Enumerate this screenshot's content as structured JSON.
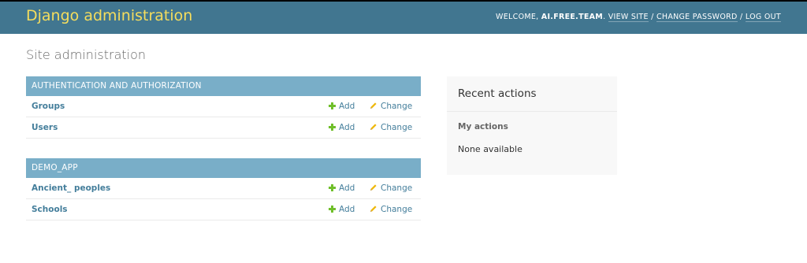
{
  "header": {
    "site_name": "Django administration",
    "welcome": "WELCOME,",
    "username": "AI.FREE.TEAM",
    "view_site": "VIEW SITE",
    "separator": "/",
    "change_password": "CHANGE PASSWORD",
    "logout": "LOG OUT"
  },
  "page": {
    "title": "Site administration"
  },
  "apps": [
    {
      "caption": "AUTHENTICATION AND AUTHORIZATION",
      "models": [
        {
          "name": "Groups",
          "add": "Add",
          "change": "Change"
        },
        {
          "name": "Users",
          "add": "Add",
          "change": "Change"
        }
      ]
    },
    {
      "caption": "DEMO_APP",
      "models": [
        {
          "name": "Ancient_ peoples",
          "add": "Add",
          "change": "Change"
        },
        {
          "name": "Schools",
          "add": "Add",
          "change": "Change"
        }
      ]
    }
  ],
  "recent_actions": {
    "title": "Recent actions",
    "subtitle": "My actions",
    "empty": "None available"
  },
  "colors": {
    "header_bg": "#417690",
    "branding": "#f5dd5d",
    "caption_bg": "#79aec8",
    "link": "#447e9b",
    "add_icon": "#70bf2b",
    "change_icon": "#efb80b"
  },
  "icons": {
    "add": "plus-icon",
    "change": "pencil-icon"
  }
}
